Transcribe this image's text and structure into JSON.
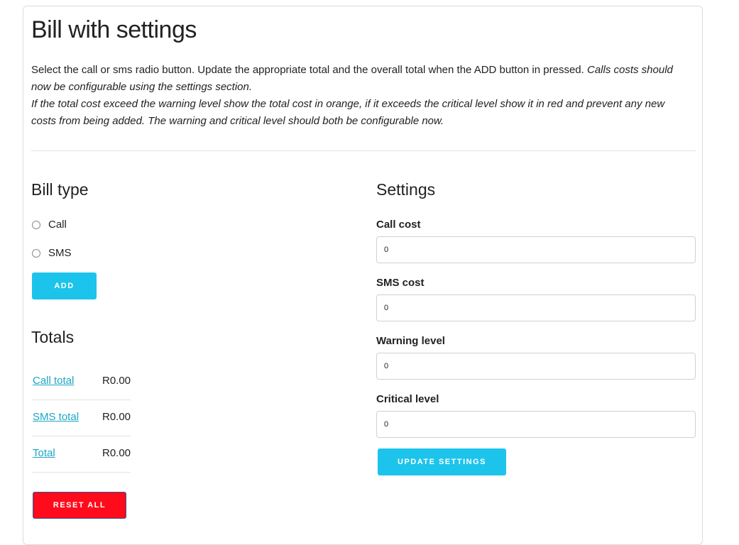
{
  "page": {
    "title": "Bill with settings",
    "description_plain": "Select the call or sms radio button. Update the appropriate total and the overall total when the ADD button in pressed.",
    "description_italic_1": "Calls costs should now be configurable using the settings section.",
    "description_italic_2": "If the total cost exceed the warning level show the total cost in orange, if it exceeds the critical level show it in red and prevent any new costs from being added. The warning and critical level should both be configurable now."
  },
  "bill_type": {
    "heading": "Bill type",
    "options": [
      {
        "label": "Call",
        "checked": false
      },
      {
        "label": "SMS",
        "checked": false
      }
    ],
    "add_label": "ADD"
  },
  "totals": {
    "heading": "Totals",
    "rows": [
      {
        "label": "Call total",
        "value": "R0.00"
      },
      {
        "label": "SMS total",
        "value": "R0.00"
      },
      {
        "label": "Total",
        "value": "R0.00"
      }
    ],
    "reset_label": "RESET ALL"
  },
  "settings": {
    "heading": "Settings",
    "fields": [
      {
        "label": "Call cost",
        "value": "0"
      },
      {
        "label": "SMS cost",
        "value": "0"
      },
      {
        "label": "Warning level",
        "value": "0"
      },
      {
        "label": "Critical level",
        "value": "0"
      }
    ],
    "update_label": "UPDATE SETTINGS"
  },
  "colors": {
    "accent": "#1cc4ec",
    "link": "#1aa7c6",
    "danger": "#ff0b1c"
  }
}
